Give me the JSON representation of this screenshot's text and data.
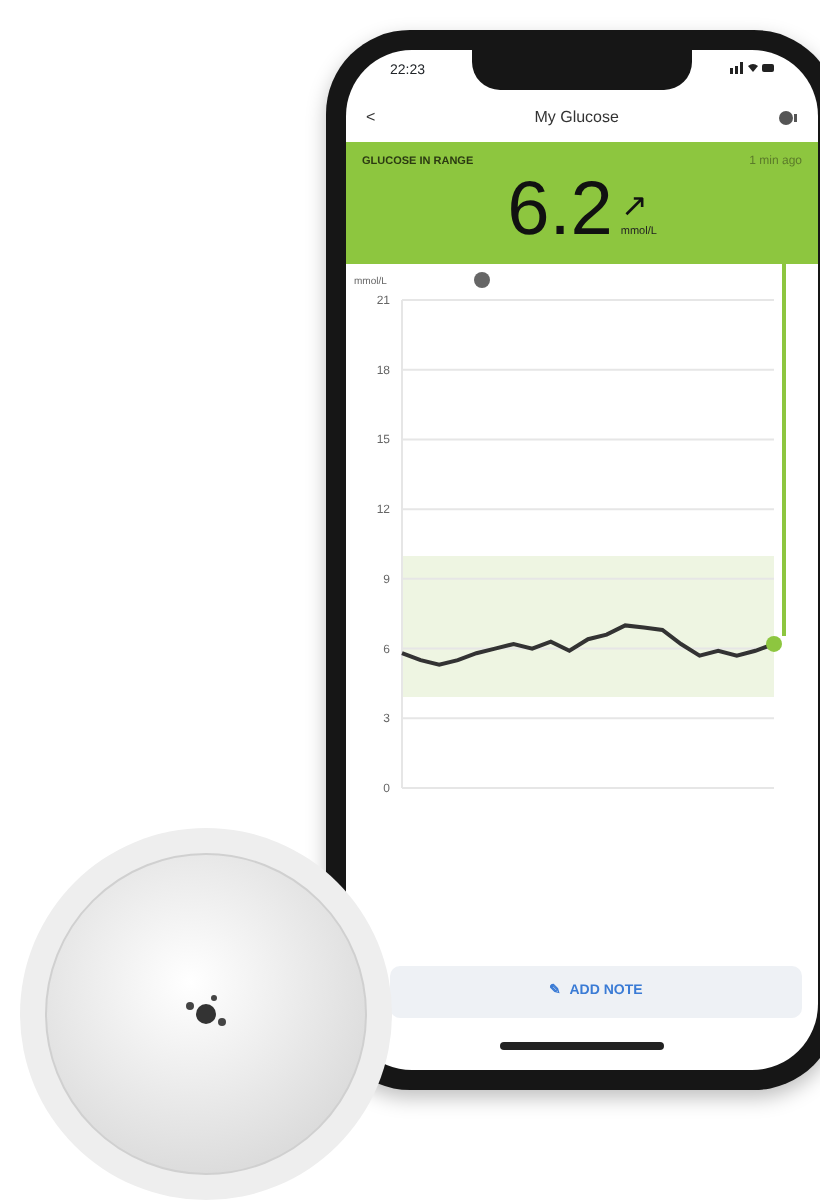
{
  "status_bar": {
    "time": "22:23"
  },
  "nav": {
    "back": "<",
    "title": "My Glucose"
  },
  "reading": {
    "status": "GLUCOSE IN RANGE",
    "age": "1 min ago",
    "value": "6.2",
    "trend": "↗",
    "unit": "mmol/L"
  },
  "chart": {
    "chart_data": {
      "type": "line",
      "ylabel": "mmol/L",
      "ylim": [
        0,
        21
      ],
      "yticks": [
        0,
        3,
        6,
        9,
        12,
        15,
        18,
        21
      ],
      "grid": true,
      "series": [
        {
          "color": "#333333",
          "values": [
            5.8,
            5.5,
            5.3,
            5.5,
            5.8,
            6.0,
            6.2,
            6.0,
            6.3,
            5.9,
            6.4,
            6.6,
            7.0,
            6.9,
            6.8,
            6.2,
            5.7,
            5.9,
            5.7,
            5.9,
            6.2
          ]
        }
      ]
    }
  },
  "add_note": {
    "icon": "✎",
    "label": "ADD NOTE"
  }
}
